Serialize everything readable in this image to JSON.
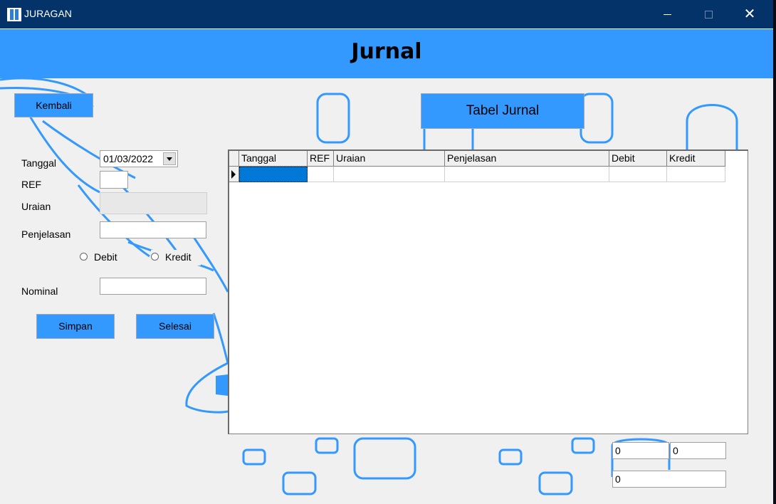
{
  "window": {
    "title": "JURAGAN",
    "minimize": "–",
    "maximize": "□",
    "close": "✕"
  },
  "header": {
    "title": "Jurnal"
  },
  "nav": {
    "back_label": "Kembali"
  },
  "table_caption": "Tabel Jurnal",
  "form": {
    "tanggal_label": "Tanggal",
    "tanggal_value": "01/03/2022",
    "ref_label": "REF",
    "ref_value": "",
    "uraian_label": "Uraian",
    "uraian_value": "",
    "penjelasan_label": "Penjelasan",
    "penjelasan_value": "",
    "debit_label": "Debit",
    "kredit_label": "Kredit",
    "nominal_label": "Nominal",
    "nominal_value": "",
    "save_label": "Simpan",
    "finish_label": "Selesai"
  },
  "grid": {
    "columns": [
      "Tanggal",
      "REF",
      "Uraian",
      "Penjelasan",
      "Debit",
      "Kredit"
    ],
    "rows": [
      [
        "",
        "",
        "",
        "",
        "",
        ""
      ]
    ]
  },
  "totals": {
    "debit_total": "0",
    "kredit_total": "0",
    "balance": "0"
  },
  "colors": {
    "titlebar": "#033368",
    "accent": "#3399ff",
    "selection": "#0078d7"
  }
}
